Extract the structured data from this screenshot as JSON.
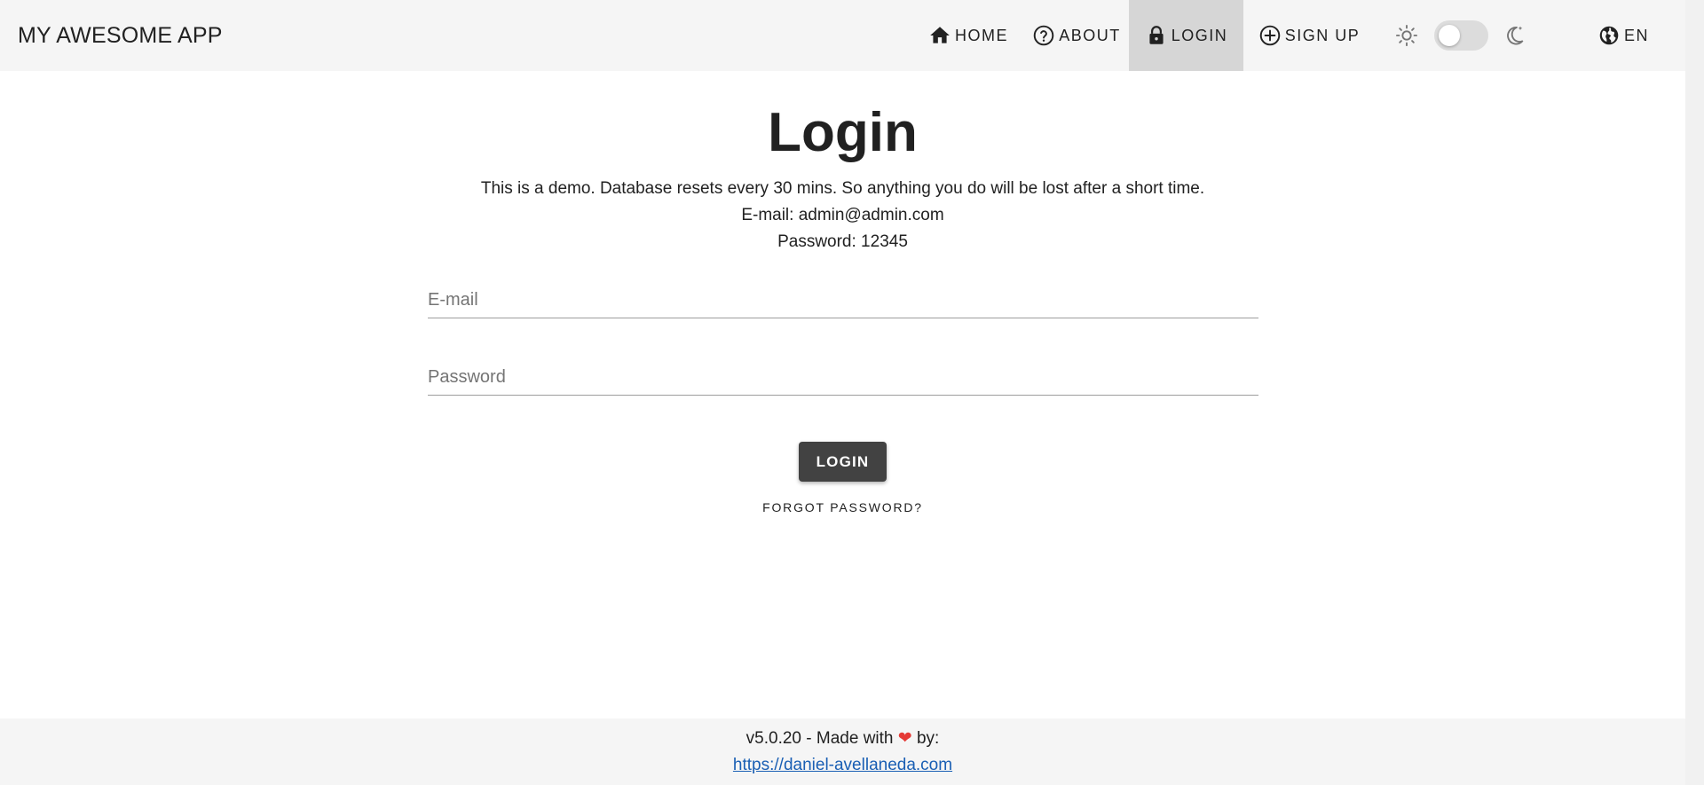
{
  "app": {
    "title": "MY AWESOME APP"
  },
  "nav": {
    "home": {
      "label": "HOME",
      "icon": "home-icon"
    },
    "about": {
      "label": "ABOUT",
      "icon": "help-circle-icon"
    },
    "login": {
      "label": "LOGIN",
      "icon": "lock-icon",
      "active": true
    },
    "signup": {
      "label": "SIGN UP",
      "icon": "plus-circle-icon"
    },
    "theme": {
      "light_icon": "sun-icon",
      "dark_icon": "moon-icon",
      "dark_mode": false
    },
    "language": {
      "label": "EN",
      "icon": "globe-icon"
    }
  },
  "main": {
    "title": "Login",
    "info": [
      "This is a demo. Database resets every 30 mins. So anything you do will be lost after a short time.",
      "E-mail: admin@admin.com",
      "Password: 12345"
    ],
    "email": {
      "placeholder": "E-mail",
      "value": ""
    },
    "password": {
      "placeholder": "Password",
      "value": ""
    },
    "login_button": "LOGIN",
    "forgot_link": "FORGOT PASSWORD?"
  },
  "footer": {
    "made_with_prefix": "v5.0.20 - Made with",
    "heart": "❤",
    "made_with_suffix": "by:",
    "link": "https://daniel-avellaneda.com"
  },
  "colors": {
    "topbar_bg": "#f5f5f5",
    "active_nav_bg": "#d6d6d6",
    "button_bg": "#424242",
    "heart": "#e53935",
    "link": "#1a5fb4"
  }
}
